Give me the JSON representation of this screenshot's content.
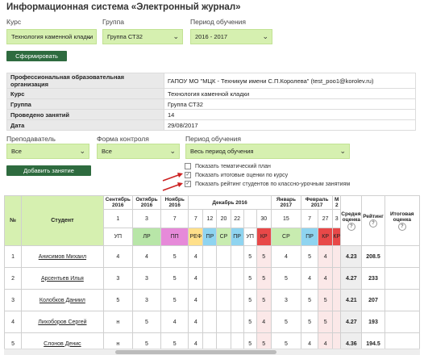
{
  "page_title": "Информационная система «Электронный журнал»",
  "filters": {
    "course": {
      "label": "Курс",
      "value": "Технология каменной кладки"
    },
    "group": {
      "label": "Группа",
      "value": "Группа СТ32"
    },
    "period": {
      "label": "Период обучения",
      "value": "2016 - 2017"
    },
    "generate_button": "Сформировать"
  },
  "info_table": [
    {
      "key": "Профессиональная образовательная организация",
      "value": "ГАПОУ МО \"МЦК - Техникум имени С.П.Королева\" (test_poo1@korolev.ru)"
    },
    {
      "key": "Курс",
      "value": "Технология каменной кладки"
    },
    {
      "key": "Группа",
      "value": "Группа СТ32"
    },
    {
      "key": "Проведено занятий",
      "value": "14"
    },
    {
      "key": "Дата",
      "value": "29/08/2017"
    }
  ],
  "filters2": {
    "teacher": {
      "label": "Преподаватель",
      "value": "Все"
    },
    "control_form": {
      "label": "Форма контроля",
      "value": "Все"
    },
    "period": {
      "label": "Период обучения",
      "value": "Весь период обучения"
    },
    "add_lesson_button": "Добавить занятие"
  },
  "checkboxes": [
    {
      "label": "Показать тематический план",
      "checked": false
    },
    {
      "label": "Показать итоговые оценки по курсу",
      "checked": true
    },
    {
      "label": "Показать рейтинг студентов по классно-урочным занятиям",
      "checked": true
    }
  ],
  "annotation_arrow_color": "#cc2222",
  "grid": {
    "col_no": "№",
    "col_student": "Студент",
    "months": [
      {
        "label": "Сентябрь 2016",
        "span": 1
      },
      {
        "label": "Октябрь 2016",
        "span": 1
      },
      {
        "label": "Ноябрь 2016",
        "span": 1
      },
      {
        "label": "Декабрь 2016",
        "span": 6
      },
      {
        "label": "Январь 2017",
        "span": 1
      },
      {
        "label": "Февраль 2017",
        "span": 2
      },
      {
        "label": "М 2",
        "span": 1
      }
    ],
    "days": [
      "1",
      "3",
      "7",
      "7",
      "12",
      "20",
      "22",
      "",
      "30",
      "15",
      "7",
      "27",
      "3"
    ],
    "types": [
      {
        "label": "УП",
        "color": "#ffffff"
      },
      {
        "label": "ЛР",
        "color": "#b8e6a8"
      },
      {
        "label": "ПП",
        "color": "#e68ad9"
      },
      {
        "label": "РЕФ",
        "color": "#ffe08a"
      },
      {
        "label": "ПР",
        "color": "#8fd4f0"
      },
      {
        "label": "СР",
        "color": "#c8ecb0"
      },
      {
        "label": "ПР",
        "color": "#8fd4f0"
      },
      {
        "label": "УП",
        "color": "#ffffff"
      },
      {
        "label": "КР",
        "color": "#e84848"
      },
      {
        "label": "СР",
        "color": "#c8ecb0"
      },
      {
        "label": "ПР",
        "color": "#8fd4f0"
      },
      {
        "label": "КР",
        "color": "#e84848"
      },
      {
        "label": "КР",
        "color": "#e84848"
      }
    ],
    "col_avg": "Средняя оценка",
    "col_rating": "Рейтинг",
    "col_final": "Итоговая оценка",
    "rows": [
      {
        "no": "1",
        "name": "Анисимов Михаил",
        "marks": [
          "4",
          "4",
          "5",
          "4",
          "",
          "",
          "",
          "5",
          "5",
          "4",
          "5",
          "4",
          ""
        ],
        "avg": "4.23",
        "rating": "208.5",
        "final": ""
      },
      {
        "no": "2",
        "name": "Арсентьев Илья",
        "marks": [
          "3",
          "3",
          "5",
          "4",
          "",
          "",
          "",
          "5",
          "5",
          "5",
          "4",
          "4",
          ""
        ],
        "avg": "4.27",
        "rating": "233",
        "final": ""
      },
      {
        "no": "3",
        "name": "Колобков Даниил",
        "marks": [
          "5",
          "3",
          "5",
          "4",
          "",
          "",
          "",
          "5",
          "5",
          "3",
          "5",
          "5",
          ""
        ],
        "avg": "4.21",
        "rating": "207",
        "final": ""
      },
      {
        "no": "4",
        "name": "Лихоборов Сергей",
        "marks": [
          "н",
          "5",
          "4",
          "4",
          "",
          "",
          "",
          "5",
          "4",
          "5",
          "5",
          "5",
          ""
        ],
        "avg": "4.27",
        "rating": "193",
        "final": ""
      },
      {
        "no": "5",
        "name": "Слонов Денис",
        "marks": [
          "н",
          "5",
          "5",
          "4",
          "",
          "",
          "",
          "5",
          "5",
          "5",
          "4",
          "4",
          ""
        ],
        "avg": "4.36",
        "rating": "194.5",
        "final": ""
      }
    ]
  }
}
